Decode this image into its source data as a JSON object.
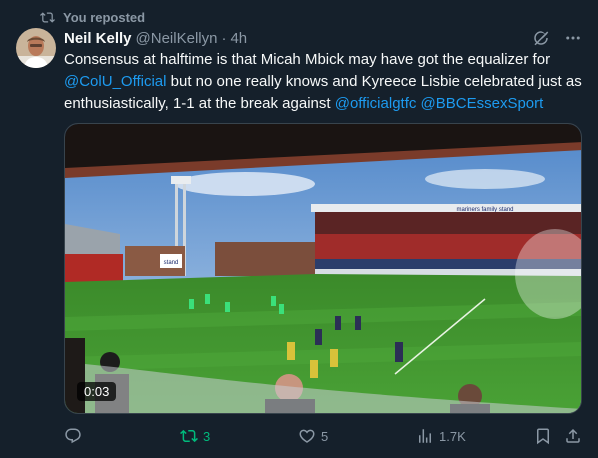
{
  "repost_banner": {
    "icon": "repost-icon",
    "text": "You reposted"
  },
  "author": {
    "name": "Neil Kelly",
    "handle": "@NeilKellyn",
    "separator": "·",
    "time": "4h"
  },
  "tweet": {
    "segments": [
      {
        "text": "Consensus at halftime is that Micah Mbick may have got the equalizer for ",
        "type": "text"
      },
      {
        "text": "@ColU_Official",
        "type": "mention"
      },
      {
        "text": " but no one really knows and Kyreece Lisbie celebrated just as enthusiastically, 1-1 at the break against ",
        "type": "text"
      },
      {
        "text": "@officialgtfc",
        "type": "mention"
      },
      {
        "text": " ",
        "type": "text"
      },
      {
        "text": "@BBCEssexSport",
        "type": "mention"
      }
    ]
  },
  "media": {
    "duration": "0:03",
    "stand_sign_left": "stand",
    "stand_sign_right": "mariners family stand"
  },
  "actions": {
    "reply": {
      "icon": "reply-icon",
      "count": ""
    },
    "repost": {
      "icon": "repost-icon",
      "count": "3",
      "active": true
    },
    "like": {
      "icon": "heart-icon",
      "count": "5"
    },
    "views": {
      "icon": "views-icon",
      "count": "1.7K"
    },
    "bookmark": {
      "icon": "bookmark-icon"
    },
    "share": {
      "icon": "share-icon"
    }
  },
  "colors": {
    "background": "#15202b",
    "text": "#f7f9f9",
    "muted": "#8b98a5",
    "link": "#1d9bf0",
    "repost_active": "#00ba7c",
    "pitch": "#3f8a2c"
  }
}
